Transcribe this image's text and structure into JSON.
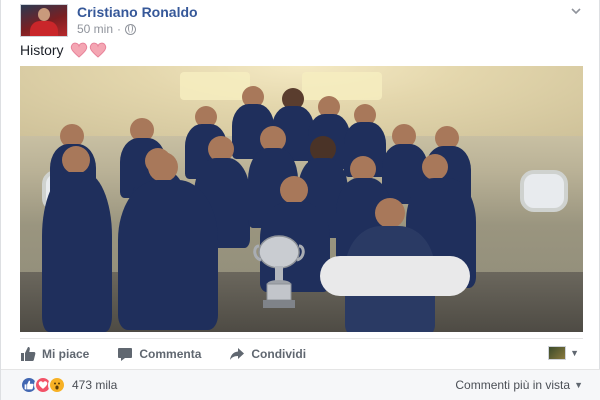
{
  "post": {
    "author": "Cristiano Ronaldo",
    "timestamp": "50 min",
    "privacy_separator": "·",
    "audience_icon": "globe-icon",
    "text": "History",
    "text_emoji": "two-hearts-icon"
  },
  "actions": {
    "like_label": "Mi piace",
    "comment_label": "Commenta",
    "share_label": "Condividi"
  },
  "footer": {
    "reaction_count": "473 mila",
    "reactions": [
      "like",
      "love",
      "wow"
    ],
    "sort_label": "Commenti più in vista"
  },
  "colors": {
    "author_link": "#365899",
    "like_blue": "#4267b2",
    "love_red": "#f25268",
    "wow_yellow": "#f7b125",
    "heart_pink": "#f4a6b3"
  }
}
